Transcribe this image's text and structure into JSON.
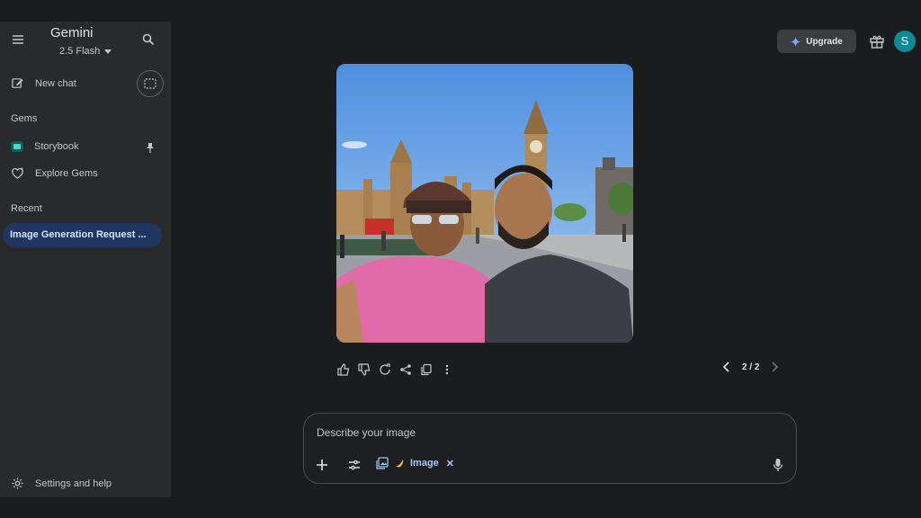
{
  "sidebar": {
    "app_title": "Gemini",
    "model": "2.5 Flash",
    "new_chat": "New chat",
    "gems_label": "Gems",
    "gems": [
      {
        "label": "Storybook",
        "icon": "storybook-icon"
      },
      {
        "label": "Explore Gems",
        "icon": "explore-gems-icon"
      }
    ],
    "recent_label": "Recent",
    "recent_items": [
      {
        "label": "Image Generation Request ..."
      }
    ],
    "settings": "Settings and help"
  },
  "header": {
    "upgrade_label": "Upgrade",
    "avatar_initial": "S"
  },
  "response": {
    "image_alt": "Selfie of two men in front of Big Ben and the Houses of Parliament, London",
    "pager": "2 / 2"
  },
  "prompt": {
    "placeholder": "Describe your image",
    "chip_label": "Image"
  },
  "colors": {
    "background": "#1b1c1d",
    "sidebar": "#282a2c",
    "active_item": "#1f3760",
    "accent": "#a8c7fa",
    "avatar": "#0e8a96"
  }
}
